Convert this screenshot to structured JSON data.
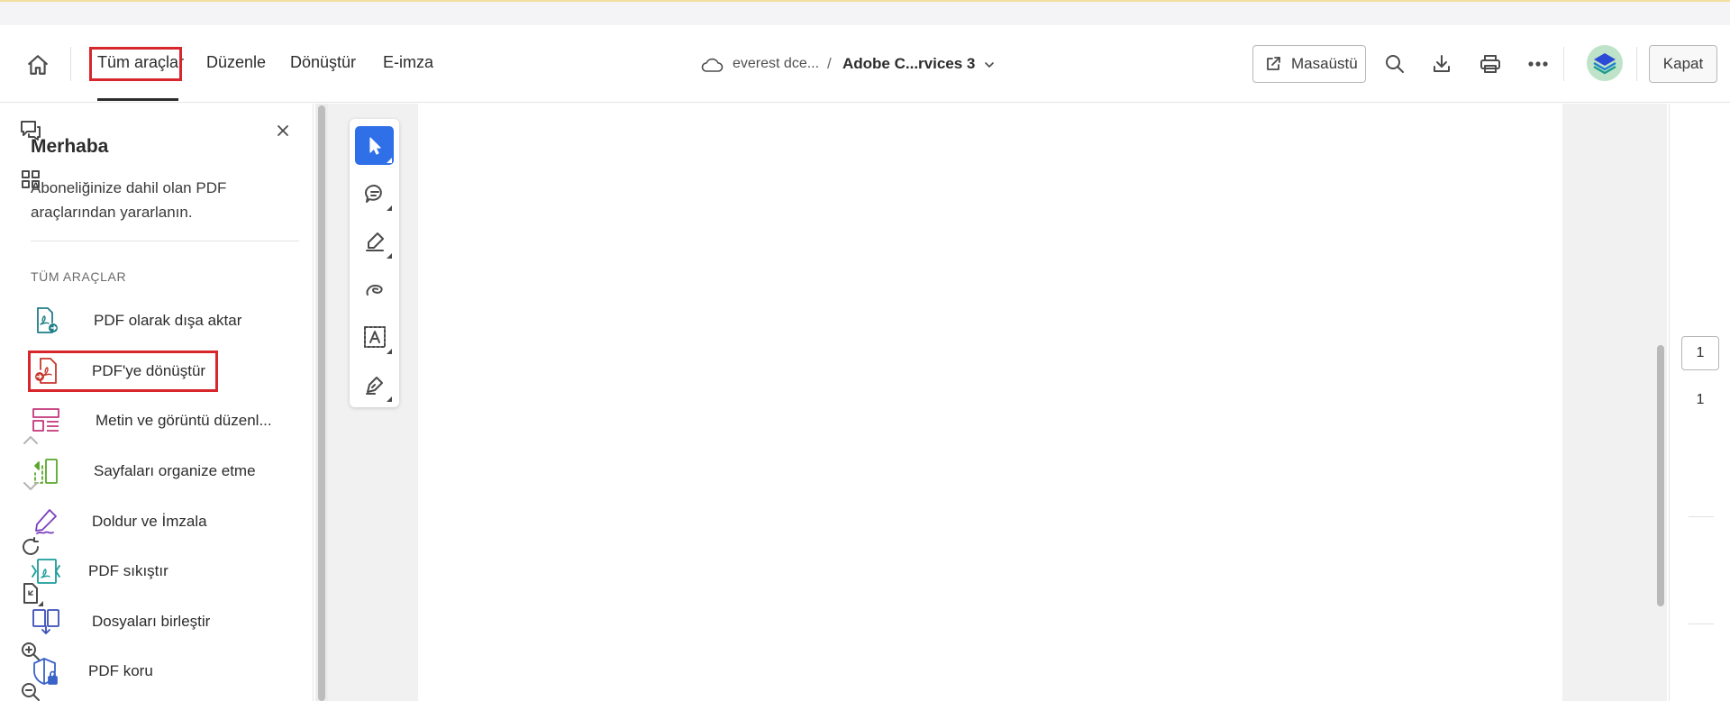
{
  "header": {
    "nav_tabs": [
      "Tüm araçlar",
      "Düzenle",
      "Dönüştür",
      "E-imza"
    ],
    "breadcrumb_folder": "everest dce...",
    "breadcrumb_separator": "/",
    "document_title": "Adobe C...rvices 3",
    "desktop_button": "Masaüstü",
    "close_button": "Kapat"
  },
  "panel": {
    "title": "Merhaba",
    "description_line1": "Aboneliğinize dahil olan PDF",
    "description_line2": "araçlarından yararlanın.",
    "section_label": "TÜM ARAÇLAR",
    "tools": [
      {
        "label": "PDF olarak dışa aktar",
        "icon": "export-pdf-icon"
      },
      {
        "label": "PDF'ye dönüştür",
        "icon": "convert-to-pdf-icon"
      },
      {
        "label": "Metin ve görüntü düzenl...",
        "icon": "edit-text-image-icon"
      },
      {
        "label": "Sayfaları organize etme",
        "icon": "organize-pages-icon"
      },
      {
        "label": "Doldur ve İmzala",
        "icon": "fill-sign-icon"
      },
      {
        "label": "PDF sıkıştır",
        "icon": "compress-pdf-icon"
      },
      {
        "label": "Dosyaları birleştir",
        "icon": "combine-files-icon"
      },
      {
        "label": "PDF koru",
        "icon": "protect-pdf-icon"
      }
    ]
  },
  "page_nav": {
    "current_page": "1",
    "total_pages": "1"
  },
  "colors": {
    "accent_blue": "#2f6fe8",
    "highlight_red": "#d7262c"
  }
}
